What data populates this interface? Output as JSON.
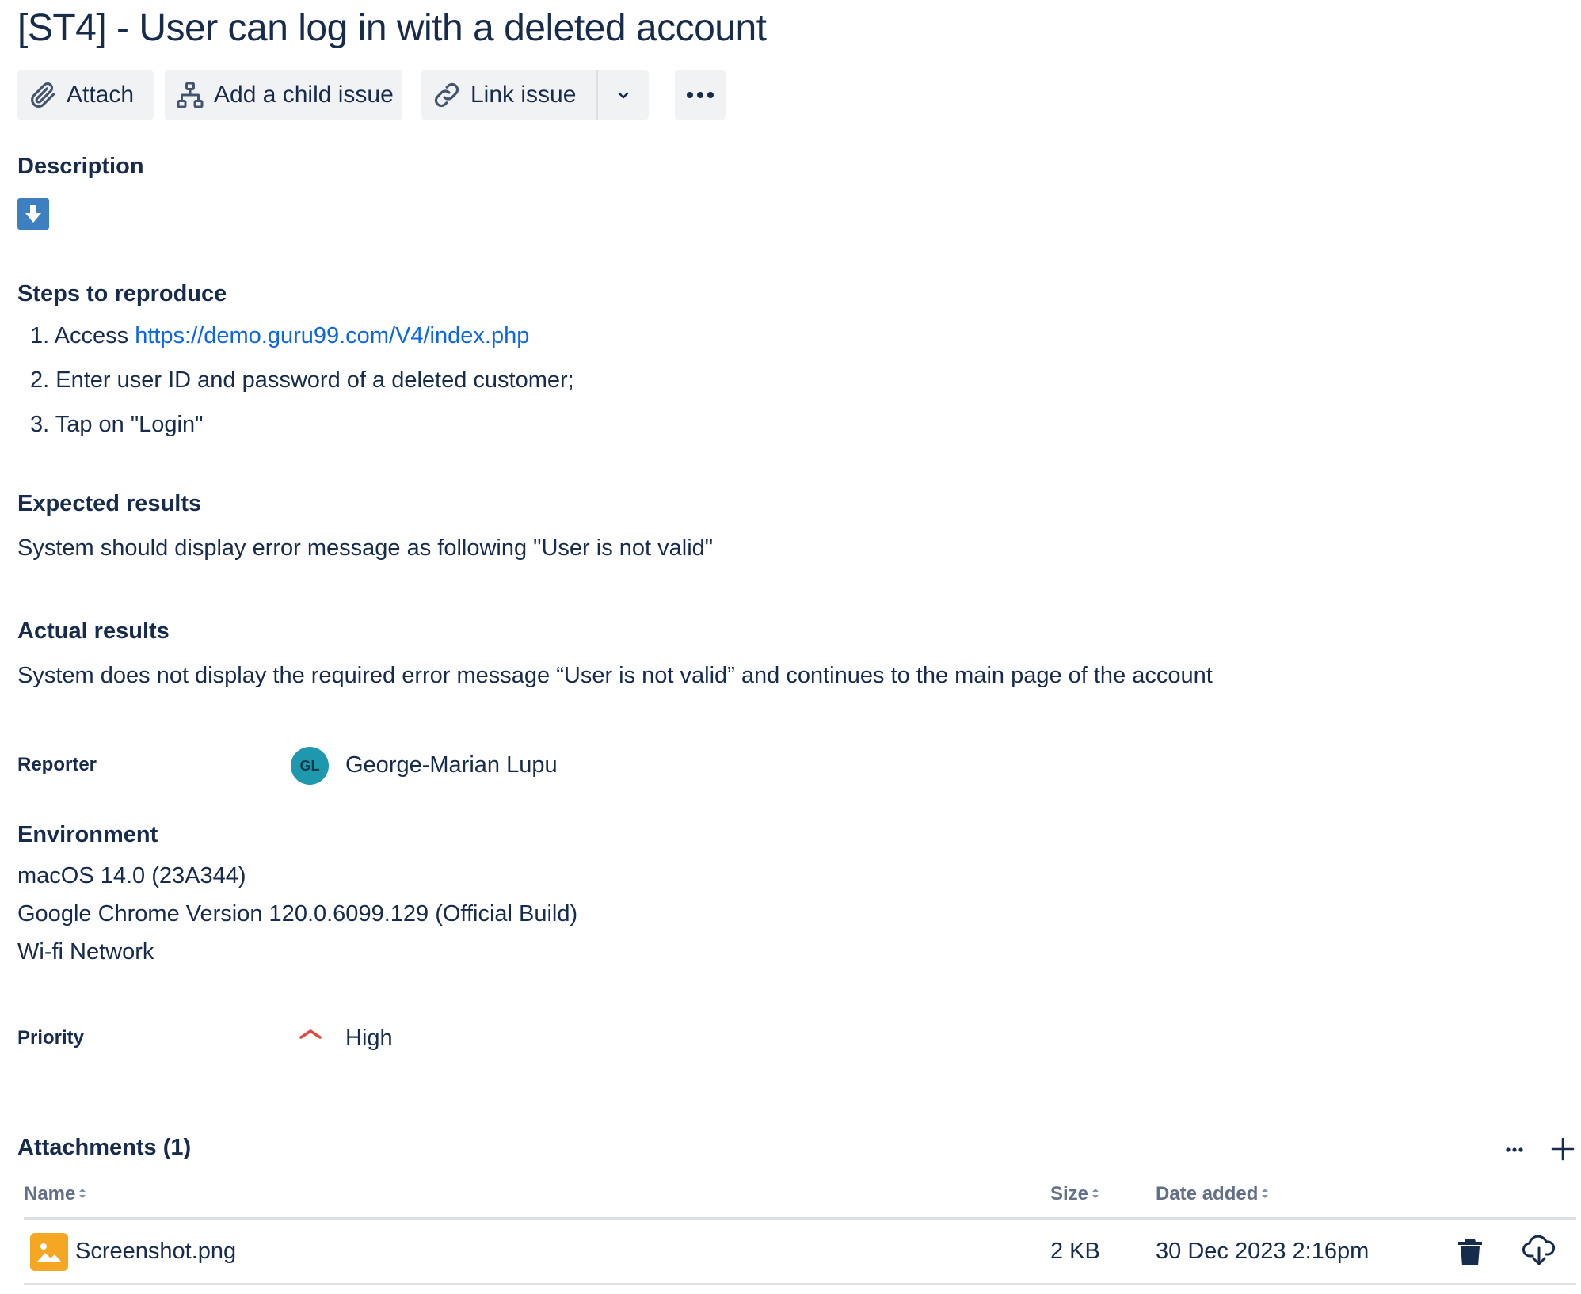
{
  "issue": {
    "title": "[ST4] - User can log in with a deleted account"
  },
  "toolbar": {
    "attach_label": "Attach",
    "add_child_label": "Add a child issue",
    "link_issue_label": "Link issue"
  },
  "description": {
    "heading": "Description",
    "steps_heading": "Steps to reproduce",
    "steps": [
      {
        "num": "1.",
        "text": "Access ",
        "link": "https://demo.guru99.com/V4/index.php"
      },
      {
        "num": "2.",
        "text": "Enter user ID and password of a deleted customer;"
      },
      {
        "num": "3.",
        "text": "Tap on \"Login\""
      }
    ],
    "expected_heading": "Expected results",
    "expected_text": "System should display error message as following \"User is not valid\"",
    "actual_heading": "Actual results",
    "actual_text": "System does not display the required error message “User is not valid” and continues to the main page of the account"
  },
  "reporter": {
    "label": "Reporter",
    "initials": "GL",
    "name": "George-Marian Lupu"
  },
  "environment": {
    "heading": "Environment",
    "lines": [
      "macOS 14.0 (23A344)",
      "Google Chrome Version 120.0.6099.129 (Official Build)",
      "Wi-fi Network"
    ]
  },
  "priority": {
    "label": "Priority",
    "value": "High",
    "color": "#e2483d"
  },
  "attachments": {
    "heading": "Attachments (1)",
    "columns": {
      "name": "Name",
      "size": "Size",
      "date": "Date added"
    },
    "rows": [
      {
        "name": "Screenshot.png",
        "size": "2 KB",
        "date": "30 Dec 2023 2:16pm"
      }
    ]
  },
  "colors": {
    "text": "#172b4d",
    "link": "#0c66e4",
    "button_bg": "#f1f2f4",
    "avatar_bg": "#1f97ad",
    "description_icon": "#3d7fc1",
    "image_icon": "#f5a623"
  }
}
